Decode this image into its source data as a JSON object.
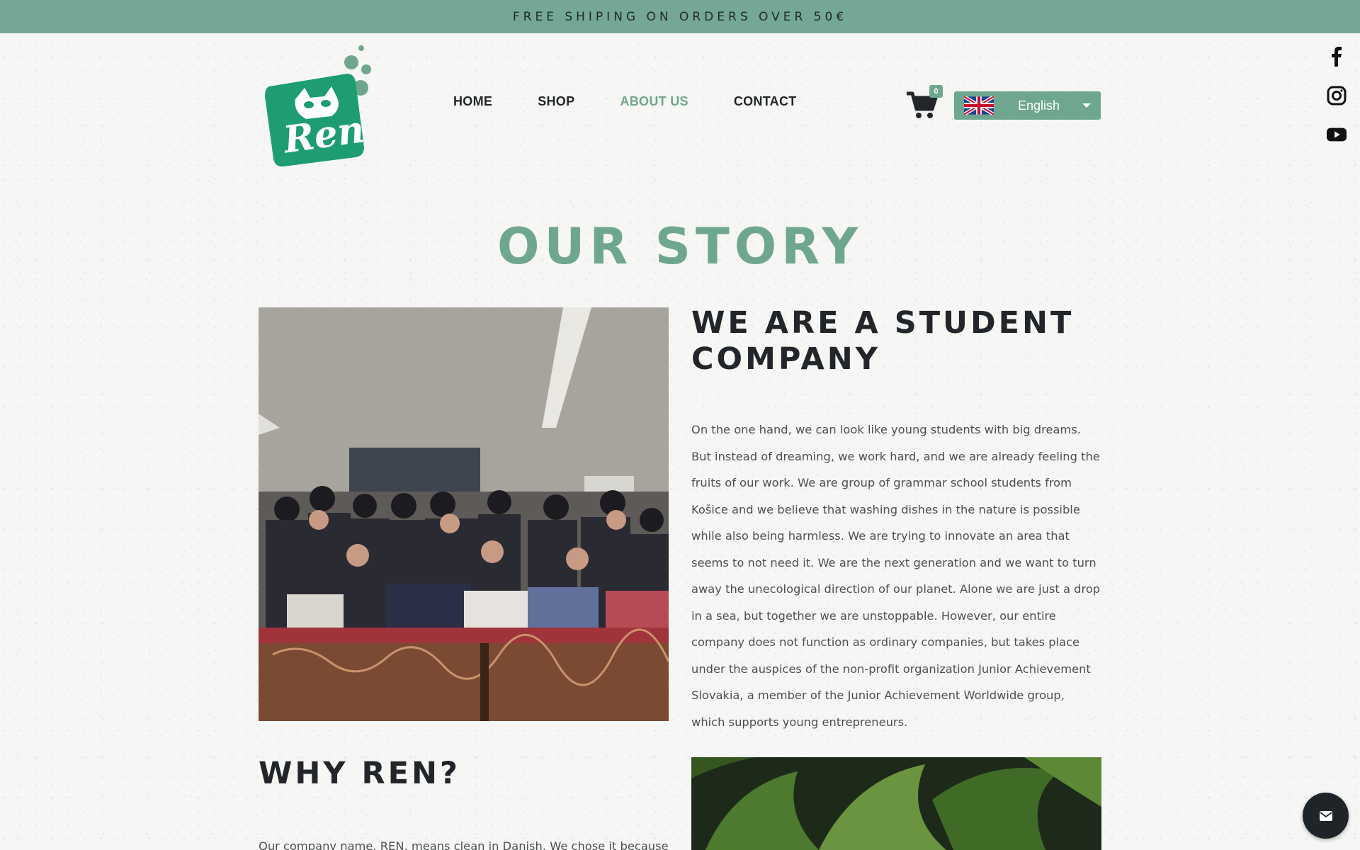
{
  "banner": {
    "text": "FREE SHIPING ON ORDERS OVER 50€"
  },
  "logo": {
    "text": "Ren",
    "icon": "raccoon-logo"
  },
  "nav": {
    "items": [
      {
        "label": "HOME",
        "active": false
      },
      {
        "label": "SHOP",
        "active": false
      },
      {
        "label": "ABOUT US",
        "active": true
      },
      {
        "label": "CONTACT",
        "active": false
      }
    ]
  },
  "cart": {
    "count": "0",
    "icon": "cart-icon"
  },
  "language": {
    "selected": "English",
    "flag": "uk-flag-icon"
  },
  "social": [
    "facebook-icon",
    "instagram-icon",
    "youtube-icon"
  ],
  "page": {
    "title": "OUR STORY",
    "student_heading": "WE ARE A STUDENT COMPANY",
    "student_text": "On the one hand, we can look like young students with big dreams. But instead of dreaming, we work hard, and we are already feeling the fruits of our work. We are group of grammar school students from Košice and we believe that washing dishes in the nature is possible while also being harmless. We are trying to innovate an area that seems to not need it. We are the next generation and we want to turn away the unecological direction of our planet. Alone we are just a drop in a sea, but together we are unstoppable. However, our entire company does not function as ordinary companies, but takes place under the auspices of the non-profit organization Junior Achievement Slovakia, a member of the Junior Achievement Worldwide group, which supports young entrepreneurs.",
    "why_heading": "WHY REN?",
    "why_text": "Our company name, REN, means clean in Danish. We chose it because it is"
  },
  "colors": {
    "accent": "#6fa68f",
    "banner": "#74a894",
    "dark": "#22262a"
  }
}
